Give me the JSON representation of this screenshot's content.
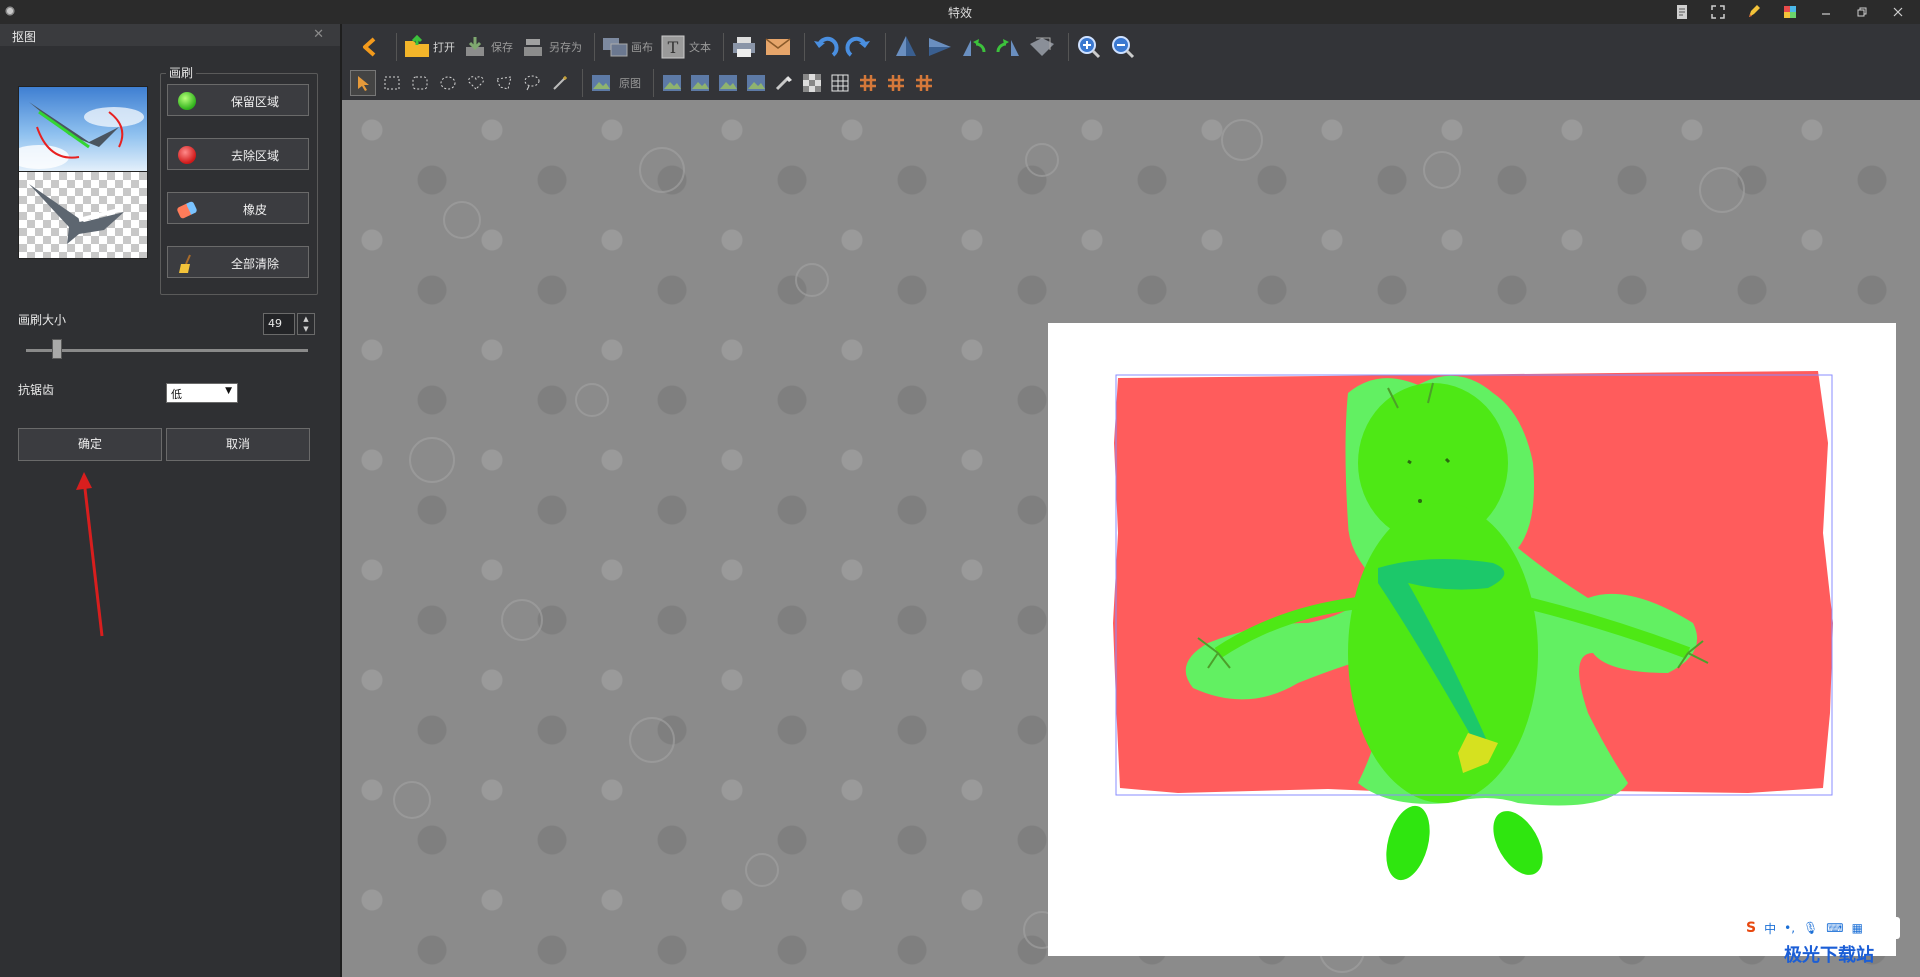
{
  "window": {
    "title": "特效"
  },
  "panel": {
    "title": "抠图",
    "brush_group_title": "画刷",
    "buttons": {
      "keep": "保留区域",
      "remove": "去除区域",
      "eraser": "橡皮",
      "clear_all": "全部清除"
    },
    "brush_size_label": "画刷大小",
    "brush_size_value": "49",
    "brush_size_fraction": 0.12,
    "antialias_label": "抗锯齿",
    "antialias_value": "低",
    "ok": "确定",
    "cancel": "取消"
  },
  "toolbar": {
    "open": "打开",
    "save": "保存",
    "save_as": "另存为",
    "canvas": "画布",
    "text": "文本",
    "original": "原图"
  },
  "watermark": {
    "text": "极光下载站",
    "ime_label": "中"
  },
  "colors": {
    "keep_area": "#5cf55c",
    "remove_area": "#ff5c5c",
    "figure": "#4ee815",
    "accent_arrow": "#d81e1e"
  }
}
